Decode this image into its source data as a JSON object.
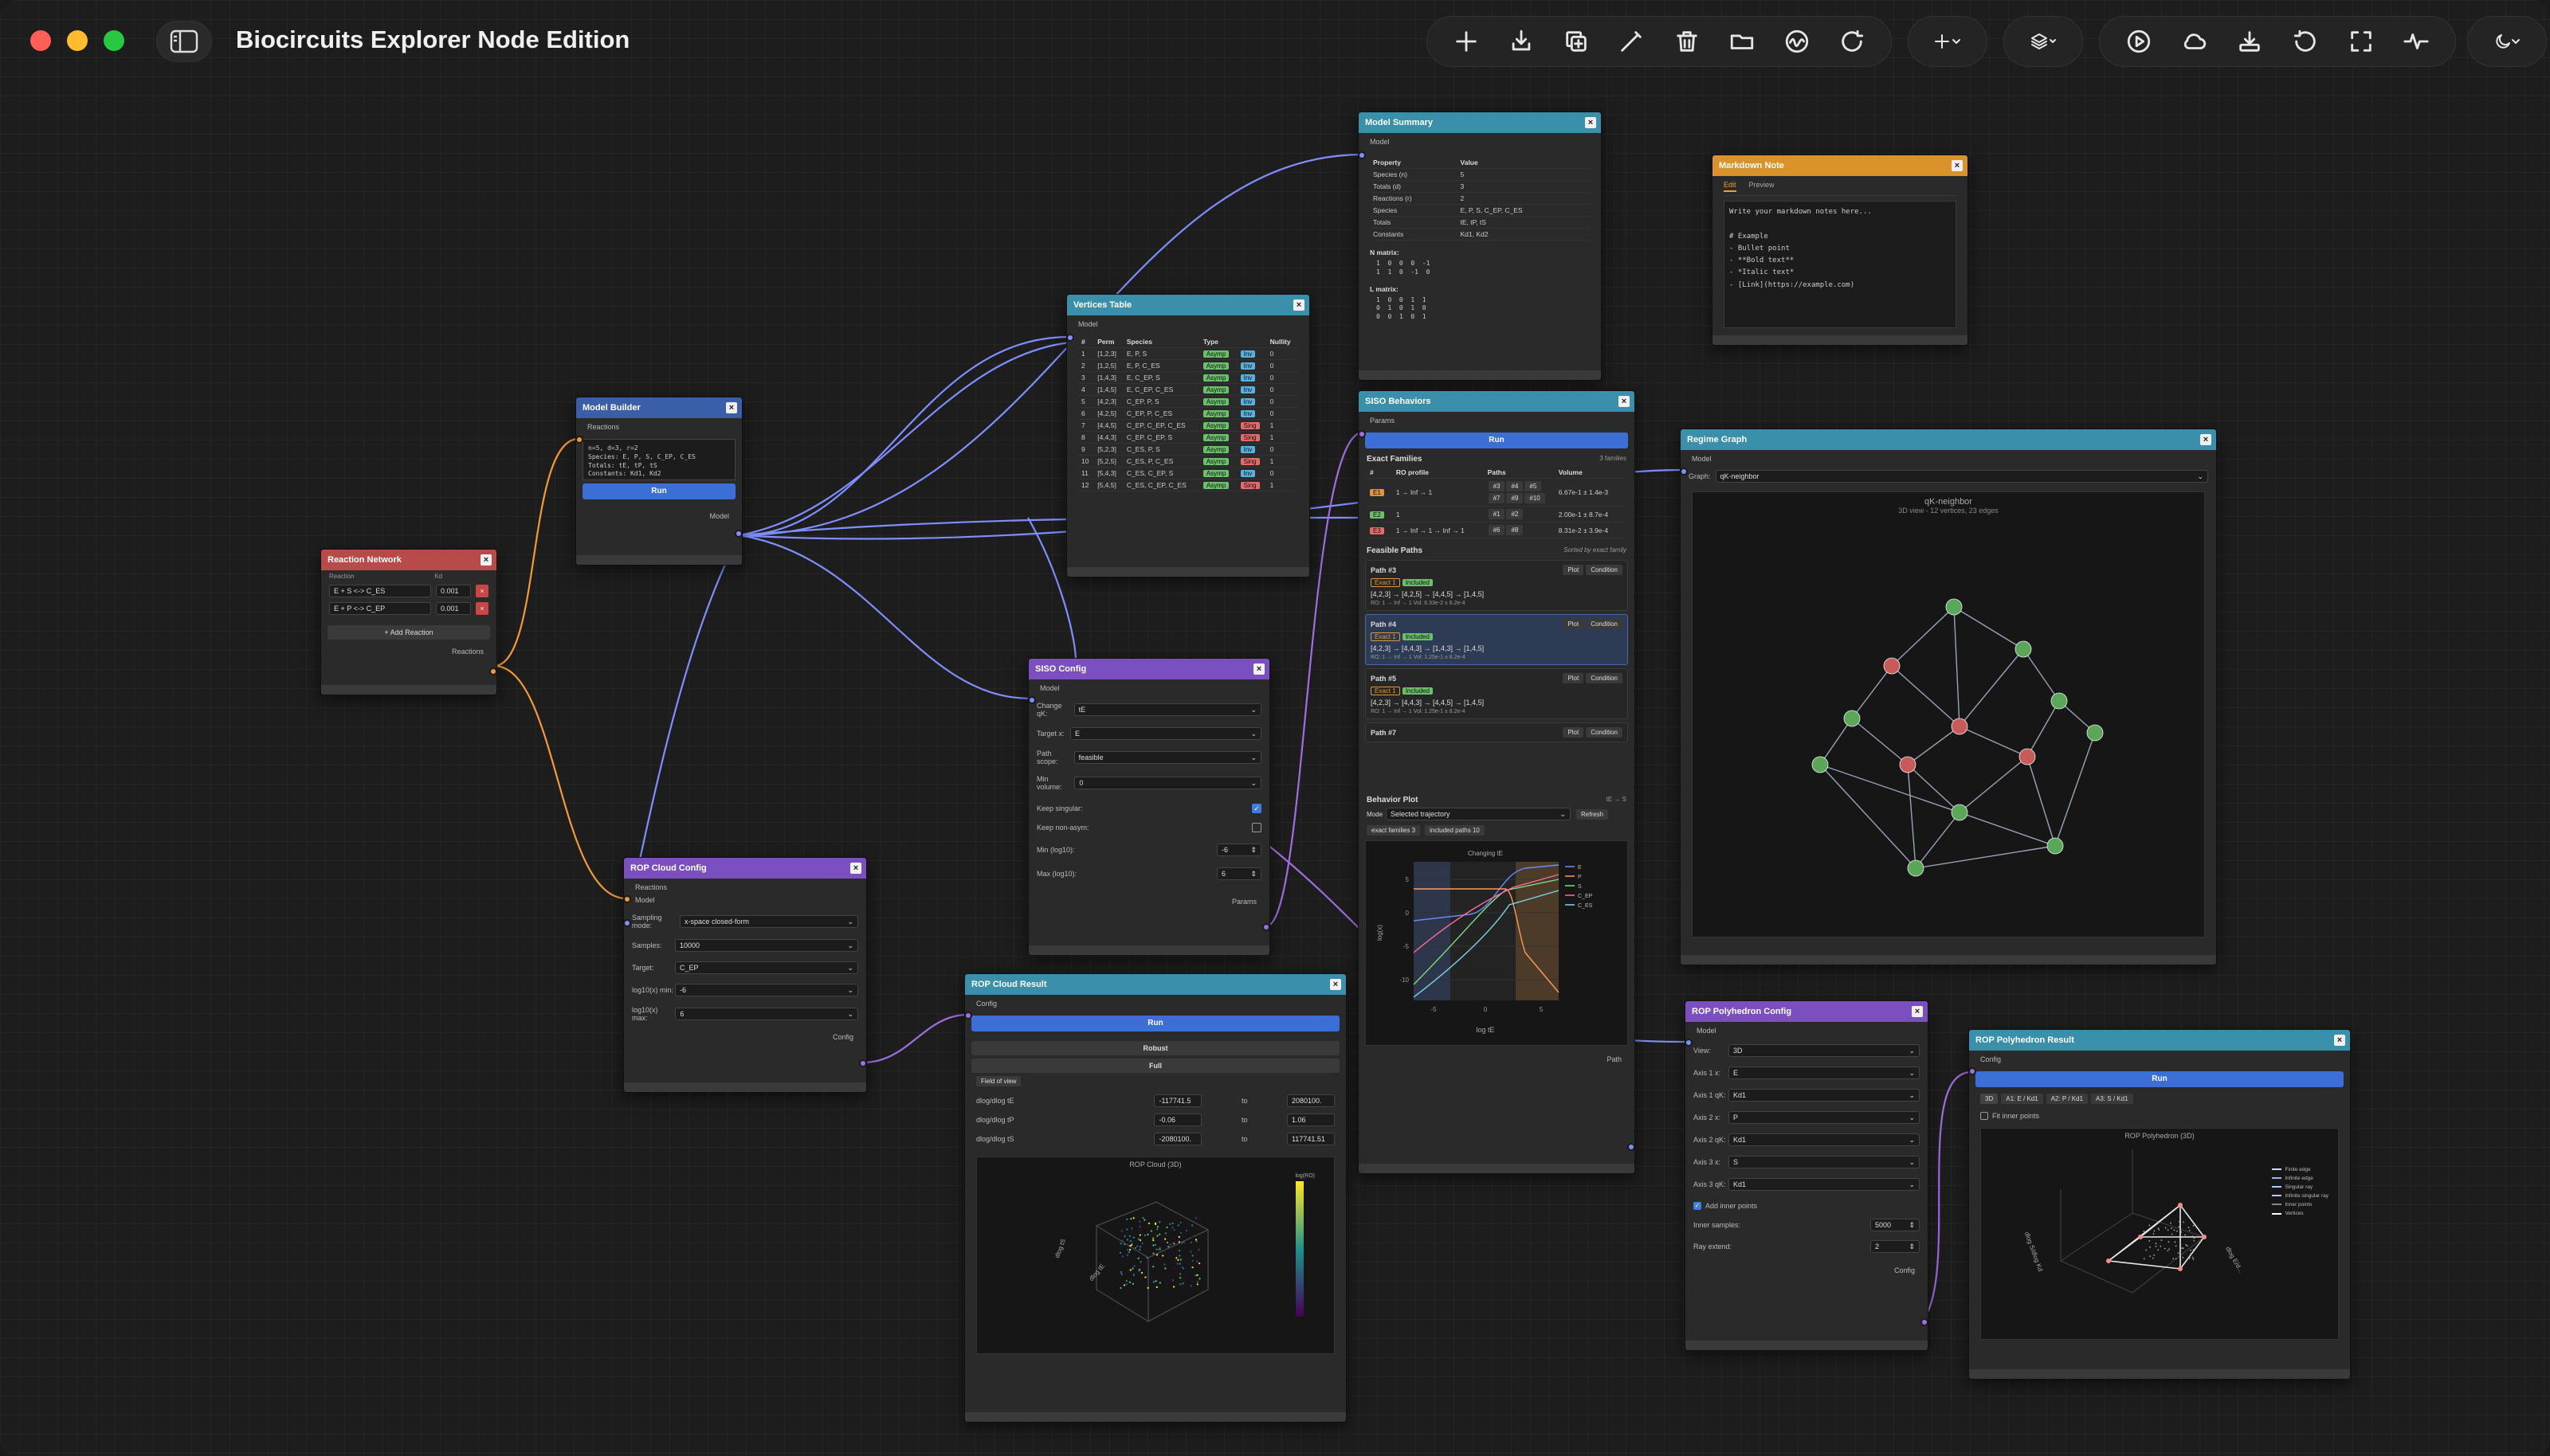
{
  "app": {
    "title": "Biocircuits Explorer Node Edition"
  },
  "toolbar": {
    "group1": [
      "plus-icon",
      "import-icon",
      "duplicate-icon",
      "pen-icon",
      "trash-icon",
      "folder-icon",
      "activity-icon",
      "refresh-icon"
    ],
    "group2": [
      "add-menu-icon"
    ],
    "group3": [
      "layers-icon"
    ],
    "group4": [
      "play-icon",
      "cloud-icon",
      "download-icon",
      "undo-icon",
      "fullscreen-icon",
      "pulse-icon"
    ],
    "group5": [
      "theme-icon"
    ]
  },
  "reaction_network": {
    "title": "Reaction Network",
    "col_reaction": "Reaction",
    "col_kd": "Kd",
    "reactions": [
      {
        "eq": "E + S <-> C_ES",
        "kd": "0.001"
      },
      {
        "eq": "E + P <-> C_EP",
        "kd": "0.001"
      }
    ],
    "add_label": "+ Add Reaction",
    "out_label": "Reactions"
  },
  "model_builder": {
    "title": "Model Builder",
    "in_label": "Reactions",
    "code": "n=5, d=3, r=2\nSpecies: E, P, S, C_EP, C_ES\nTotals: tE, tP, tS\nConstants: Kd1, Kd2",
    "run_label": "Run",
    "out_label": "Model"
  },
  "model_summary": {
    "title": "Model Summary",
    "in_label": "Model",
    "headers": [
      "Property",
      "Value"
    ],
    "rows": [
      [
        "Species (n)",
        "5"
      ],
      [
        "Totals (d)",
        "3"
      ],
      [
        "Reactions (r)",
        "2"
      ],
      [
        "Species",
        "E, P, S, C_EP, C_ES"
      ],
      [
        "Totals",
        "tE, tP, tS"
      ],
      [
        "Constants",
        "Kd1, Kd2"
      ]
    ],
    "n_label": "N matrix:",
    "n_matrix": "1  0  0  0  -1\n1  1  0  -1  0",
    "l_label": "L matrix:",
    "l_matrix": "1  0  0  1  1\n0  1  0  1  0\n0  0  1  0  1"
  },
  "vertices_table": {
    "title": "Vertices Table",
    "in_label": "Model",
    "headers": [
      "#",
      "Perm",
      "Species",
      "Type",
      "",
      "Nullity"
    ],
    "rows": [
      [
        "1",
        "[1,2,3]",
        "E, P, S",
        "Asymp",
        "Inv",
        "0"
      ],
      [
        "2",
        "[1,2,5]",
        "E, P, C_ES",
        "Asymp",
        "Inv",
        "0"
      ],
      [
        "3",
        "[1,4,3]",
        "E, C_EP, S",
        "Asymp",
        "Inv",
        "0"
      ],
      [
        "4",
        "[1,4,5]",
        "E, C_EP, C_ES",
        "Asymp",
        "Inv",
        "0"
      ],
      [
        "5",
        "[4,2,3]",
        "C_EP, P, S",
        "Asymp",
        "Inv",
        "0"
      ],
      [
        "6",
        "[4,2,5]",
        "C_EP, P, C_ES",
        "Asymp",
        "Inv",
        "0"
      ],
      [
        "7",
        "[4,4,5]",
        "C_EP, C_EP, C_ES",
        "Asymp",
        "Sing",
        "1"
      ],
      [
        "8",
        "[4,4,3]",
        "C_EP, C_EP, S",
        "Asymp",
        "Sing",
        "1"
      ],
      [
        "9",
        "[5,2,3]",
        "C_ES, P, S",
        "Asymp",
        "Inv",
        "0"
      ],
      [
        "10",
        "[5,2,5]",
        "C_ES, P, C_ES",
        "Asymp",
        "Sing",
        "1"
      ],
      [
        "11",
        "[5,4,3]",
        "C_ES, C_EP, S",
        "Asymp",
        "Inv",
        "0"
      ],
      [
        "12",
        "[5,4,5]",
        "C_ES, C_EP, C_ES",
        "Asymp",
        "Sing",
        "1"
      ]
    ]
  },
  "siso_behaviors": {
    "title": "SISO Behaviors",
    "in_label": "Params",
    "run_label": "Run",
    "exact_title": "Exact Families",
    "exact_count": "3 families",
    "exact_headers": [
      "#",
      "RO profile",
      "Paths",
      "Volume"
    ],
    "families": [
      {
        "id": "E1",
        "profile": "1 → Inf → 1",
        "paths": [
          "#3",
          "#4",
          "#5",
          "#7",
          "#9",
          "#10"
        ],
        "volume": "6.67e-1 ± 1.4e-3"
      },
      {
        "id": "E2",
        "profile": "1",
        "paths": [
          "#1",
          "#2"
        ],
        "volume": "2.00e-1 ± 8.7e-4"
      },
      {
        "id": "E3",
        "profile": "1 → Inf → 1 → Inf → 1",
        "paths": [
          "#6",
          "#8"
        ],
        "volume": "8.31e-2 ± 3.9e-4"
      }
    ],
    "feasible_title": "Feasible Paths",
    "feasible_sort": "Sorted by exact family",
    "paths": [
      {
        "name": "Path #3",
        "fam": "Exact 1",
        "inc": "Included",
        "seq": "[4,2,3] → [4,2,5] → [4,4,5] → [1,4,5]",
        "meta": "RO: 1 → Inf → 1   Vol: 6.33e-2 ± 6.2e-4",
        "sel": false
      },
      {
        "name": "Path #4",
        "fam": "Exact 1",
        "inc": "Included",
        "seq": "[4,2,3] → [4,4,3] → [1,4,3] → [1,4,5]",
        "meta": "RO: 1 → Inf → 1   Vol: 1.25e-1 ± 8.2e-4",
        "sel": true
      },
      {
        "name": "Path #5",
        "fam": "Exact 1",
        "inc": "Included",
        "seq": "[4,2,3] → [4,4,3] → [4,4,5] → [1,4,5]",
        "meta": "RO: 1 → Inf → 1   Vol: 1.25e-1 ± 8.2e-4",
        "sel": false
      },
      {
        "name": "Path #7",
        "fam": "",
        "inc": "",
        "seq": "",
        "meta": "",
        "sel": false
      }
    ],
    "plot_label": "Plot",
    "condition_label": "Condition",
    "behavior_title": "Behavior Plot",
    "behavior_tag": "tE → S",
    "mode_label": "Mode",
    "mode_value": "Selected trajectory",
    "refresh_label": "Refresh",
    "chip1": "exact families 3",
    "chip2": "included paths 10",
    "plot_title": "Changing tE",
    "xlabel": "log tE",
    "ylabel": "log(x)",
    "legend": [
      "E",
      "P",
      "S",
      "C_EP",
      "C_ES"
    ],
    "xticks": [
      "-5",
      "0",
      "5"
    ],
    "yticks": [
      "5",
      "0",
      "-5",
      "-10"
    ],
    "out_label": "Path"
  },
  "markdown_note": {
    "title": "Markdown Note",
    "tab_edit": "Edit",
    "tab_preview": "Preview",
    "text": "Write your markdown notes here...\n\n# Example\n- Bullet point\n- **Bold text**\n- *Italic text*\n- [Link](https://example.com)"
  },
  "regime_graph": {
    "title": "Regime Graph",
    "in_label": "Model",
    "graph_label": "Graph:",
    "graph_value": "qK-neighbor",
    "plot_title": "qK-neighbor",
    "plot_sub": "3D view - 12 vertices, 23 edges"
  },
  "siso_config": {
    "title": "SISO Config",
    "in_label": "Model",
    "fields": [
      {
        "label": "Change qK:",
        "value": "tE"
      },
      {
        "label": "Target x:",
        "value": "E"
      },
      {
        "label": "Path scope:",
        "value": "feasible"
      },
      {
        "label": "Min volume:",
        "value": "0"
      }
    ],
    "keep_singular": "Keep singular:",
    "keep_nonasym": "Keep non-asym:",
    "min_label": "Min (log10):",
    "min_value": "-6",
    "max_label": "Max (log10):",
    "max_value": "6",
    "out_label": "Params"
  },
  "rop_cloud_config": {
    "title": "ROP Cloud Config",
    "in1": "Reactions",
    "in2": "Model",
    "fields": [
      {
        "label": "Sampling mode:",
        "value": "x-space closed-form"
      },
      {
        "label": "Samples:",
        "value": "10000"
      },
      {
        "label": "Target:",
        "value": "C_EP"
      },
      {
        "label": "log10(x) min:",
        "value": "-6"
      },
      {
        "label": "log10(x) max:",
        "value": "6"
      }
    ],
    "out_label": "Config"
  },
  "rop_cloud_result": {
    "title": "ROP Cloud Result",
    "in_label": "Config",
    "run_label": "Run",
    "robust": "Robust",
    "full": "Full",
    "fov": "Field of view",
    "ranges": [
      {
        "label": "dlog/dlog tE",
        "from": "-117741.5",
        "to": "2080100."
      },
      {
        "label": "dlog/dlog tP",
        "from": "-0.06",
        "to": "1.06"
      },
      {
        "label": "dlog/dlog tS",
        "from": "-2080100.",
        "to": "117741.51"
      }
    ],
    "to_label": "to",
    "plot_title": "ROP Cloud (3D)",
    "cbar_label": "log(RO)",
    "axis_a": "dlog tS",
    "axis_b": "dlog tE"
  },
  "rop_poly_config": {
    "title": "ROP Polyhedron Config",
    "in_label": "Model",
    "fields": [
      {
        "label": "View:",
        "value": "3D"
      },
      {
        "label": "Axis 1 x:",
        "value": "E"
      },
      {
        "label": "Axis 1 qK:",
        "value": "Kd1"
      },
      {
        "label": "Axis 2 x:",
        "value": "P"
      },
      {
        "label": "Axis 2 qK:",
        "value": "Kd1"
      },
      {
        "label": "Axis 3 x:",
        "value": "S"
      },
      {
        "label": "Axis 3 qK:",
        "value": "Kd1"
      }
    ],
    "add_inner": "Add inner points",
    "inner_label": "Inner samples:",
    "inner_value": "5000",
    "ray_label": "Ray extend:",
    "ray_value": "2",
    "out_label": "Config"
  },
  "rop_poly_result": {
    "title": "ROP Polyhedron Result",
    "in_label": "Config",
    "run_label": "Run",
    "tabs": [
      "3D",
      "A1: E / Kd1",
      "A2: P / Kd1",
      "A3: S / Kd1"
    ],
    "fit_inner": "Fit inner points",
    "plot_title": "ROP Polyhedron (3D)",
    "legend": [
      "Finite edge",
      "Infinite edge",
      "Singular ray",
      "Infinite singular ray",
      "Inner points",
      "Vertices"
    ],
    "axis_a": "dlog S/dlog Kd",
    "axis_b": "dlog E/d..."
  },
  "colors": {
    "bg": "#1d1d1d",
    "node": "#2a2a2a",
    "edge_blue": "#7f8fff",
    "edge_orange": "#f29a3a",
    "edge_purple": "#a06ee0"
  }
}
